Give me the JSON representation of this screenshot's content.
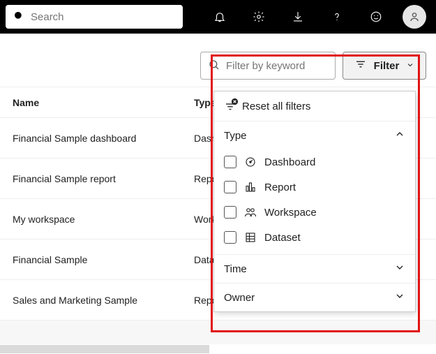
{
  "topbar": {
    "search_placeholder": "Search"
  },
  "toolbar": {
    "keyword_placeholder": "Filter by keyword",
    "filter_button_label": "Filter"
  },
  "table": {
    "columns": {
      "name": "Name",
      "type": "Type"
    },
    "rows": [
      {
        "name": "Financial Sample dashboard",
        "type": "Dashboard"
      },
      {
        "name": "Financial Sample report",
        "type": "Report"
      },
      {
        "name": "My workspace",
        "type": "Workspace"
      },
      {
        "name": "Financial Sample",
        "type": "Dataset"
      },
      {
        "name": "Sales and Marketing Sample",
        "type": "Report"
      }
    ]
  },
  "filter_panel": {
    "reset_label": "Reset all filters",
    "sections": {
      "type": {
        "label": "Type",
        "expanded": true
      },
      "time": {
        "label": "Time",
        "expanded": false
      },
      "owner": {
        "label": "Owner",
        "expanded": false
      }
    },
    "type_options": [
      {
        "label": "Dashboard"
      },
      {
        "label": "Report"
      },
      {
        "label": "Workspace"
      },
      {
        "label": "Dataset"
      }
    ]
  }
}
